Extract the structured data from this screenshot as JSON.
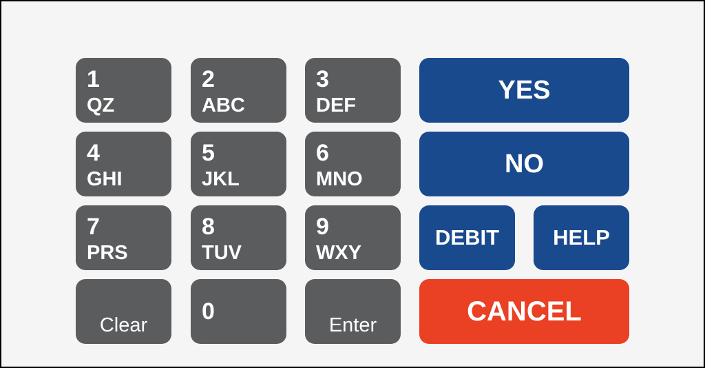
{
  "keypad": {
    "keys": [
      {
        "num": "1",
        "letters": "QZ"
      },
      {
        "num": "2",
        "letters": "ABC"
      },
      {
        "num": "3",
        "letters": "DEF"
      },
      {
        "num": "4",
        "letters": "GHI"
      },
      {
        "num": "5",
        "letters": "JKL"
      },
      {
        "num": "6",
        "letters": "MNO"
      },
      {
        "num": "7",
        "letters": "PRS"
      },
      {
        "num": "8",
        "letters": "TUV"
      },
      {
        "num": "9",
        "letters": "WXY"
      }
    ],
    "clear": "Clear",
    "zero": "0",
    "enter": "Enter"
  },
  "functions": {
    "yes": "YES",
    "no": "NO",
    "debit": "DEBIT",
    "help": "HELP",
    "cancel": "CANCEL"
  },
  "colors": {
    "key_gray": "#5b5c5e",
    "blue": "#1a4a8e",
    "cancel_red": "#ea4024",
    "background": "#f5f5f5"
  }
}
